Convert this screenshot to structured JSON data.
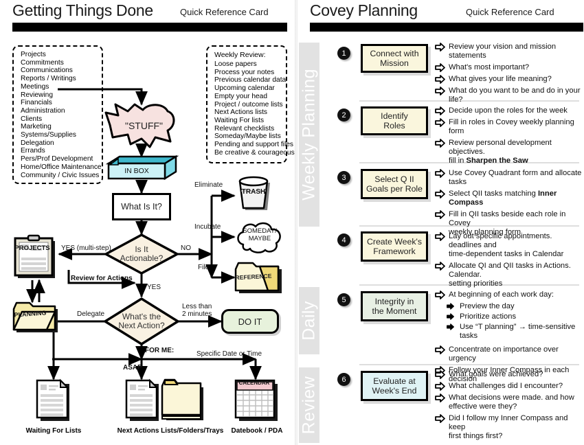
{
  "gtd": {
    "title": "Getting Things Done",
    "subtitle": "Quick Reference Card",
    "categories_box": {
      "items": [
        "Projects",
        "Commitments",
        "Communications",
        "Reports / Writings",
        "Meetings",
        "Reviewing",
        "Financials",
        "Administration",
        "Clients",
        "Marketing",
        "Systems/Supplies",
        "Delegation",
        "Errands",
        "Pers/Prof Development",
        "Home/Office Maintenance",
        "Community / Civic Issues"
      ]
    },
    "weekly_review_box": {
      "title": "Weekly Review:",
      "items": [
        "Loose papers",
        "Process your notes",
        "Previous calendar data",
        "Upcoming calendar",
        "Empty your head",
        "Project / outcome lists",
        "Next Actions lists",
        "Waiting For lists",
        "Relevant checklists",
        "Someday/Maybe lists",
        "Pending and support files",
        "Be creative & courageous"
      ]
    },
    "nodes": {
      "stuff": "\"STUFF\"",
      "inbox": "IN BOX",
      "what_is_it": "What Is It?",
      "is_it_actionable_l1": "Is It",
      "is_it_actionable_l2": "Actionable?",
      "whats_next_l1": "What's the",
      "whats_next_l2": "Next Action?",
      "do_it": "DO IT",
      "projects": "PROJECTS",
      "planning": "PLANNING",
      "trash": "TRASH",
      "someday_l1": "SOMEDAY/",
      "someday_l2": "MAYBE",
      "reference": "REFERENCE",
      "calendar": "CALENDAR"
    },
    "edge_labels": {
      "yes_multistep": "YES (multi-step)",
      "no": "NO",
      "yes": "YES",
      "eliminate": "Eliminate",
      "incubate": "Incubate",
      "file": "File",
      "review_for_actions": "Review for Actions",
      "delegate": "Delegate",
      "less_than_l1": "Less than",
      "less_than_l2": "2 minutes",
      "for_me": "FOR ME:",
      "asap": "ASAP",
      "specific_date": "Specific Date or Time"
    },
    "captions": {
      "waiting": "Waiting For Lists",
      "next_actions": "Next Actions Lists/Folders/Trays",
      "datebook": "Datebook / PDA"
    }
  },
  "covey": {
    "title": "Covey Planning",
    "subtitle": "Quick Reference Card",
    "bands": [
      {
        "label": "Weekly Planning"
      },
      {
        "label": "Daily"
      },
      {
        "label": "Review"
      }
    ],
    "steps": [
      {
        "number": "1",
        "box_l1": "Connect with",
        "box_l2": "Mission",
        "box_color": "#faf6dd",
        "bullets": [
          {
            "text": "Review your vision and mission statements"
          },
          {
            "text": "What's most important?"
          },
          {
            "text": "What gives your life meaning?"
          },
          {
            "text": "What do you want to be and do in your life?"
          }
        ]
      },
      {
        "number": "2",
        "box_l1": "Identify",
        "box_l2": "Roles",
        "box_color": "#faf6dd",
        "bullets": [
          {
            "text": "Decide upon the roles for the week"
          },
          {
            "text": "Fill in roles in Covey weekly planning form"
          },
          {
            "text": "Review personal development objectives.",
            "text2": "fill in ",
            "bold": "Sharpen the Saw"
          }
        ]
      },
      {
        "number": "3",
        "box_l1": "Select Q II",
        "box_l2": "Goals per Role",
        "box_color": "#faf6dd",
        "bullets": [
          {
            "text": "Use Covey Quadrant form and allocate tasks"
          },
          {
            "pre": "Select QII tasks matching ",
            "bold": "Inner Compass"
          },
          {
            "text": "Fill in QII tasks beside each role in Covey",
            "text2": "weekly planning form"
          }
        ]
      },
      {
        "number": "4",
        "box_l1": "Create Week's",
        "box_l2": "Framework",
        "box_color": "#faf6dd",
        "bullets": [
          {
            "text": "Lay out specific appointments. deadlines and",
            "text2": "time-dependent tasks in Calendar"
          },
          {
            "text": "Allocate QI and QII tasks in Actions. Calendar.",
            "text2": "setting priorities"
          }
        ]
      },
      {
        "number": "5",
        "box_l1": "Integrity in",
        "box_l2": "the Moment",
        "box_color": "#e8f0e4",
        "bullets": [
          {
            "text": "At beginning of each work day:"
          },
          {
            "text": "Preview the day",
            "sub": true
          },
          {
            "text": "Prioritize actions",
            "sub": true
          },
          {
            "text": "Use “T planning” → time-sensitive tasks",
            "sub": true
          },
          {
            "text": "Concentrate on importance over urgency"
          },
          {
            "text": "Follow your Inner Compass in each decision"
          }
        ]
      },
      {
        "number": "6",
        "box_l1": "Evaluate at",
        "box_l2": "Week's End",
        "box_color": "#e0f3f5",
        "bullets": [
          {
            "text": "What goals were achieved?"
          },
          {
            "text": "What challenges did I encounter?"
          },
          {
            "text": "What decisions were made. and how",
            "text2": "effective were they?"
          },
          {
            "text": "Did I follow my Inner Compass and keep",
            "text2": "first things first?"
          }
        ]
      }
    ]
  },
  "colors": {
    "stuff_fill": "#f7e2e0",
    "inbox_fill": "#ccf2f7",
    "inbox_top": "#3fb8cc",
    "diamond_fill": "#f9f1e2",
    "doit_fill": "#e7f2dc",
    "folder_fill": "#f4e9a8",
    "band_gray": "#e2e2e2"
  }
}
